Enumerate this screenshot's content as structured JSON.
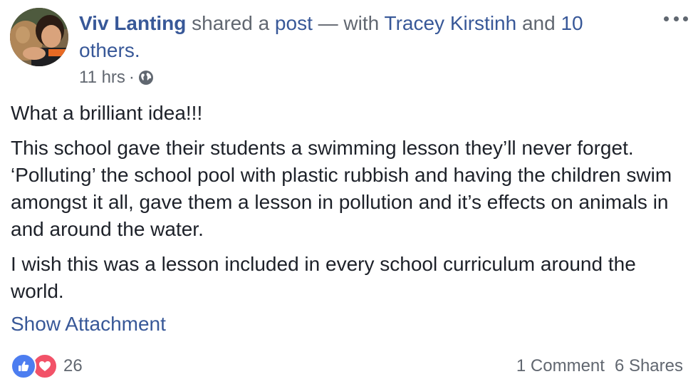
{
  "post": {
    "author": "Viv Lanting",
    "action_text": "shared a",
    "action_link": "post",
    "with_text": "— with",
    "tagged_person": "Tracey Kirstinh",
    "and_text": "and",
    "others_link": "10 others.",
    "time": "11 hrs",
    "separator": "·",
    "privacy_icon": "globe-icon",
    "more_icon": "more-dots-icon",
    "body": {
      "p1": "What a brilliant idea!!!",
      "p2": "This school gave their students a swimming lesson they’ll never forget. ‘Polluting’ the school pool with plastic rubbish and having the children swim amongst it all, gave them a lesson in pollution and it’s effects on animals in and around the water.",
      "p3": "I wish this was a lesson included in every school curriculum around the world."
    },
    "show_attachment": "Show Attachment",
    "reactions": {
      "icons": [
        "like-icon",
        "love-icon"
      ],
      "count": "26"
    },
    "comments": "1 Comment",
    "shares": "6 Shares"
  },
  "colors": {
    "link": "#385898",
    "meta_text": "#616770",
    "body_text": "#1d2129",
    "like": "#4c7df0",
    "love": "#f25268"
  }
}
